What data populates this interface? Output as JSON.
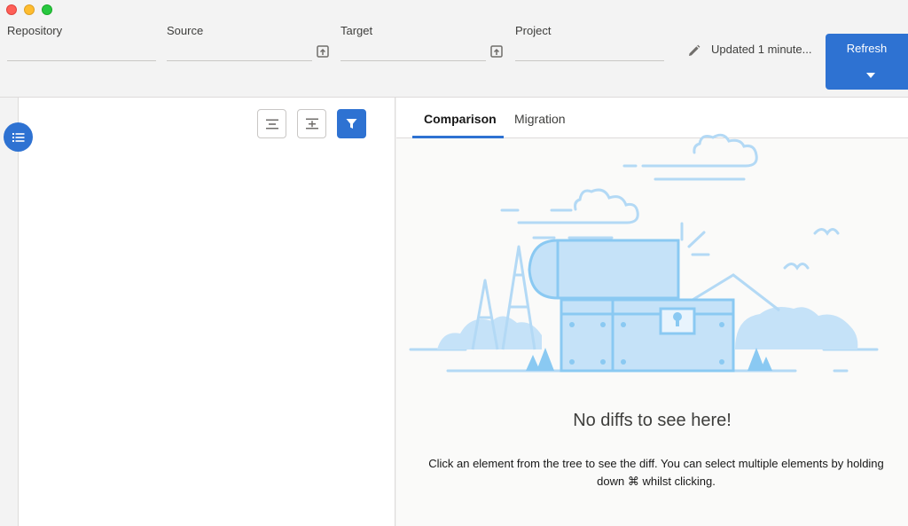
{
  "header": {
    "fields": [
      {
        "label": "Repository",
        "value": ""
      },
      {
        "label": "Source",
        "value": ""
      },
      {
        "label": "Target",
        "value": ""
      },
      {
        "label": "Project",
        "value": ""
      }
    ],
    "status_text": "Updated 1 minute...",
    "refresh_label": "Refresh"
  },
  "tree": {
    "tools": [
      "collapse-all-icon",
      "expand-all-icon",
      "filter-icon"
    ]
  },
  "tabs": [
    {
      "label": "Comparison",
      "active": true
    },
    {
      "label": "Migration",
      "active": false
    }
  ],
  "empty_state": {
    "title": "No diffs to see here!",
    "message": "Click an element from the tree to see the diff. You can select multiple elements by holding down ⌘ whilst clicking."
  },
  "colors": {
    "accent": "#2e72d2",
    "illustration": "#c5e2f8",
    "illustration_stroke": "#8ac9f2"
  }
}
